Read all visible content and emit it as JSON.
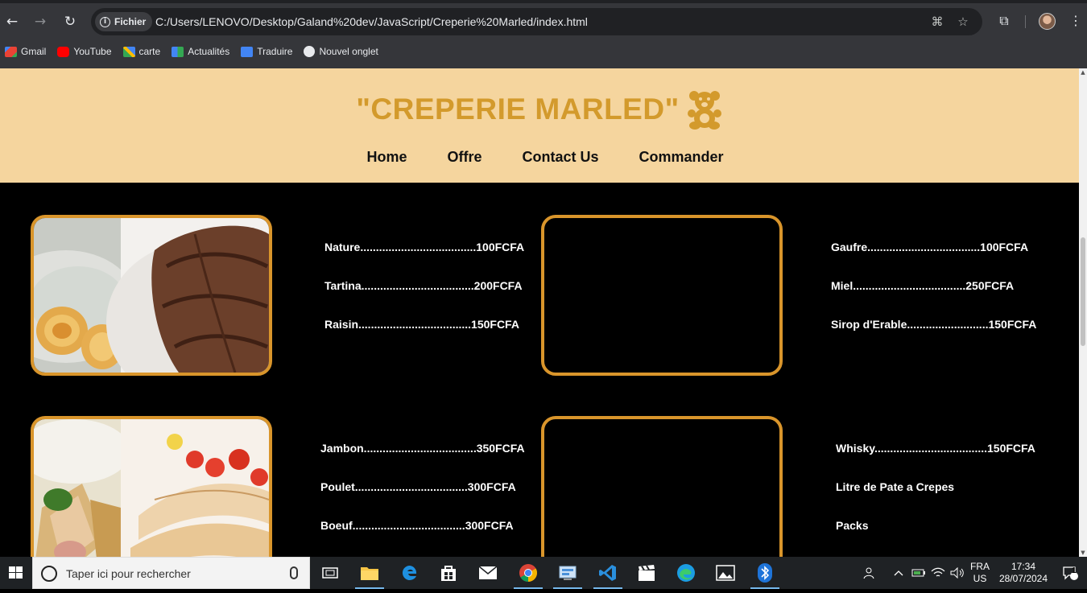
{
  "browser": {
    "url_chip": "Fichier",
    "url": "C:/Users/LENOVO/Desktop/Galand%20dev/JavaScript/Creperie%20Marled/index.html",
    "bookmarks": [
      {
        "label": "Gmail",
        "icon": "gmail-icon",
        "color": "#ea4335"
      },
      {
        "label": "YouTube",
        "icon": "youtube-icon",
        "color": "#ff0000"
      },
      {
        "label": "carte",
        "icon": "maps-icon",
        "color": "#34a853"
      },
      {
        "label": "Actualités",
        "icon": "news-icon",
        "color": "#4285f4"
      },
      {
        "label": "Traduire",
        "icon": "translate-icon",
        "color": "#4285f4"
      },
      {
        "label": "Nouvel onglet",
        "icon": "chrome-icon",
        "color": "#e8eaed"
      }
    ]
  },
  "site": {
    "brand": "\"CREPERIE MARLED\"",
    "brand_color": "#d39a2c",
    "header_bg": "#f5d59e",
    "nav": [
      "Home",
      "Offre",
      "Contact Us",
      "Commander"
    ]
  },
  "menu": {
    "row1": {
      "left": [
        "Nature.....................................100FCFA",
        "Tartina....................................200FCFA",
        "Raisin....................................150FCFA"
      ],
      "right": [
        "Gaufre....................................100FCFA",
        "Miel....................................250FCFA",
        "Sirop d'Erable..........................150FCFA"
      ]
    },
    "row2": {
      "left": [
        "Jambon....................................350FCFA",
        "Poulet....................................300FCFA",
        "Boeuf....................................300FCFA"
      ],
      "right": [
        "Whisky....................................150FCFA",
        "Litre de Pate a Crepes",
        "Packs"
      ]
    },
    "frame_color": "#d9952b"
  },
  "taskbar": {
    "search_placeholder": "Taper ici pour rechercher",
    "lang_top": "FRA",
    "lang_bottom": "US",
    "time": "17:34",
    "date": "28/07/2024",
    "notification_count": "1"
  }
}
